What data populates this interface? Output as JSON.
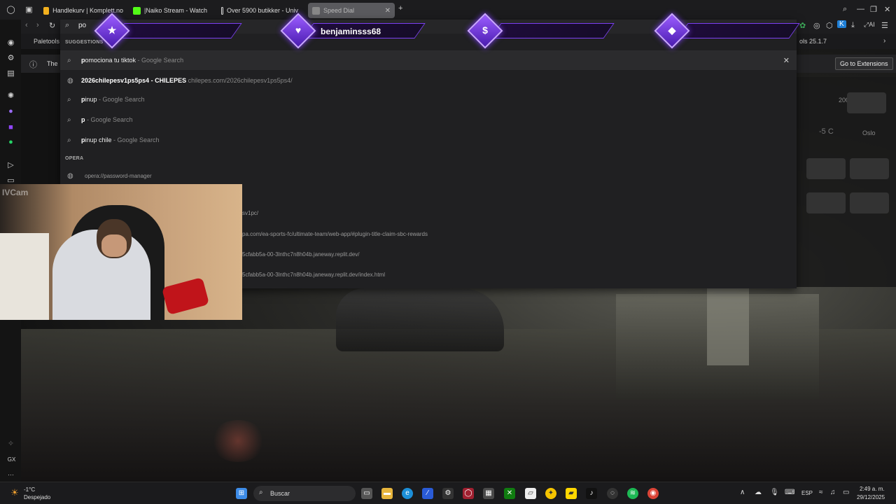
{
  "tabs": [
    {
      "label": "Handlekurv | Komplett.no",
      "color": "#f2b01e"
    },
    {
      "label": "|Naiko Stream - Watch",
      "color": "#53fc18"
    },
    {
      "label": "Over 5900 butikker - Univ",
      "color": "#dddddd"
    },
    {
      "label": "Speed Dial",
      "color": "#888888"
    }
  ],
  "address": {
    "query": "po"
  },
  "bookmarks": {
    "first": "Paletools",
    "right": "ols 25.1.7"
  },
  "infobar": {
    "text": "The",
    "button": "Go to Extensions"
  },
  "dropdown": {
    "section_suggestions": "SUGGESTIONS",
    "section_opera": "OPERA",
    "suggestions": [
      {
        "bold": "p",
        "rest": "omociona tu tiktok",
        "source": " - Google Search"
      },
      {
        "bold": "2026chilepesv1ps5ps4 - CHILEPES",
        "rest": "",
        "source": " chilepes.com/2026chilepesv1ps5ps4/"
      },
      {
        "bold": "p",
        "rest": "inup",
        "source": " - Google Search"
      },
      {
        "bold": "p",
        "rest": "",
        "source": " - Google Search"
      },
      {
        "bold": "p",
        "rest": "inup chile",
        "source": " - Google Search"
      }
    ],
    "opera_item": "opera://password-manager",
    "urls": [
      "sv1pc/",
      "pa.com/ea-sports-fc/ultimate-team/web-app/#plugin-title-claim-sbc-rewards",
      "5cfabb5a-00-3lnthc7n8h04b.janeway.replit.dev/",
      "5cfabb5a-00-3lnthc7n8h04b.janeway.replit.dev/index.html"
    ]
  },
  "overlay": {
    "name": "benjaminsss68",
    "symbols": [
      "★",
      "♥",
      "$",
      "◆"
    ],
    "accent": "#7b3ff2"
  },
  "webcam": {
    "label": "IVCam"
  },
  "right_panel": {
    "temp": "-5 C",
    "city": "Oslo"
  },
  "taskbar": {
    "weather_temp": "-1°C",
    "weather_desc": "Despejado",
    "search": "Buscar",
    "lang": "ESP",
    "time": "2:49 a. m.",
    "date": "29/12/2025"
  },
  "sidebar": {
    "gx": "GX",
    "more": "···"
  }
}
